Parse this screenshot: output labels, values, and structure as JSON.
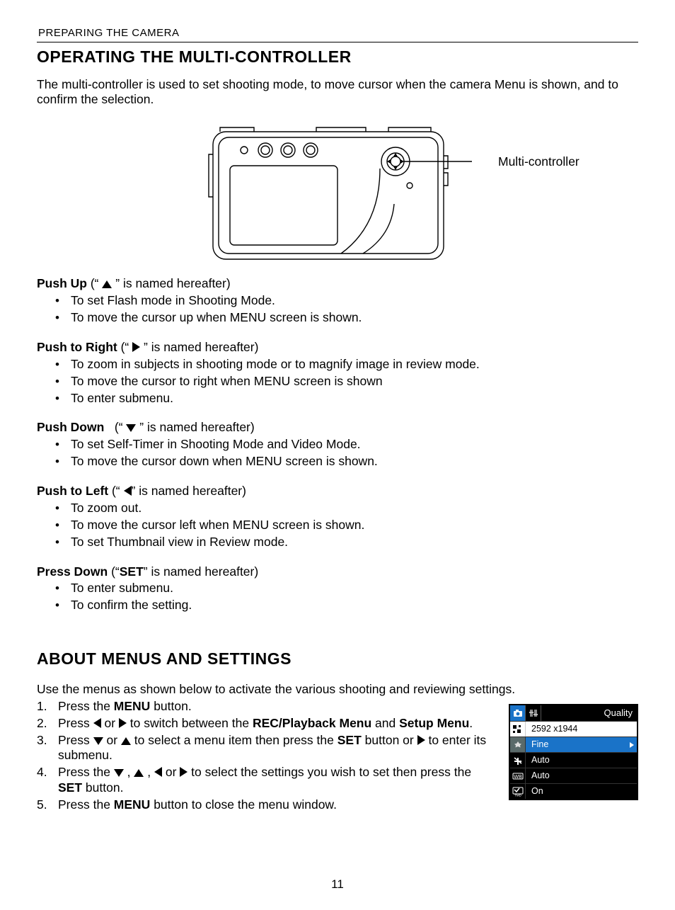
{
  "header": "PREPARING THE CAMERA",
  "title1": "OPERATING THE MULTI-CONTROLLER",
  "intro1": "The multi-controller is used to set shooting mode, to move cursor when the camera Menu is shown, and to confirm the selection.",
  "diagram_callout": "Multi-controller",
  "push_up": {
    "label": "Push Up",
    "suffix": "is named hereafter)",
    "items": [
      "To set Flash mode in Shooting Mode.",
      "To move the cursor up when MENU screen is shown."
    ]
  },
  "push_right": {
    "label": "Push to Right",
    "suffix": "is named hereafter)",
    "items": [
      "To zoom in subjects in shooting mode or to magnify image in review mode.",
      "To move the cursor to right when MENU screen is shown",
      "To enter submenu."
    ]
  },
  "push_down": {
    "label": "Push Down",
    "suffix": "is named hereafter)",
    "items": [
      "To set Self-Timer in Shooting Mode and Video Mode.",
      "To move the cursor down when MENU screen is shown."
    ]
  },
  "push_left": {
    "label": "Push to Left",
    "suffix": "is named hereafter)",
    "items": [
      "To zoom out.",
      "To move the cursor left when MENU screen is shown.",
      "To set Thumbnail view in Review mode."
    ]
  },
  "press_down": {
    "label": "Press Down",
    "set": "SET",
    "suffix_a": "(“",
    "suffix_b": "” is named hereafter)",
    "items": [
      "To enter submenu.",
      "To confirm the setting."
    ]
  },
  "title2": "ABOUT MENUS AND SETTINGS",
  "intro2": "Use the menus as shown below to activate the various shooting and reviewing settings.",
  "steps": {
    "s1a": "Press the ",
    "s1b": "MENU",
    "s1c": " button.",
    "s2a": "Press ",
    "s2b": " or ",
    "s2c": " to switch between the ",
    "s2d": "REC/Playback Menu",
    "s2e": " and ",
    "s2f": "Setup Menu",
    "s2g": ".",
    "s3a": "Press ",
    "s3b": " or ",
    "s3c": " to select a menu item then press the ",
    "s3d": "SET",
    "s3e": " button or ",
    "s3f": " to enter its submenu.",
    "s4a": "Press the ",
    "s4b": " , ",
    "s4c": " , ",
    "s4d": " or ",
    "s4e": " to select the settings you wish to set then press the ",
    "s4f": "SET",
    "s4g": " button.",
    "s5a": "Press the ",
    "s5b": "MENU",
    "s5c": " button to close the menu window."
  },
  "menu": {
    "title": "Quality",
    "rows": [
      {
        "value": "2592 x1944"
      },
      {
        "value": "Fine"
      },
      {
        "value": "Auto"
      },
      {
        "value": "Auto"
      },
      {
        "value": "On"
      }
    ]
  },
  "page_number": "11"
}
